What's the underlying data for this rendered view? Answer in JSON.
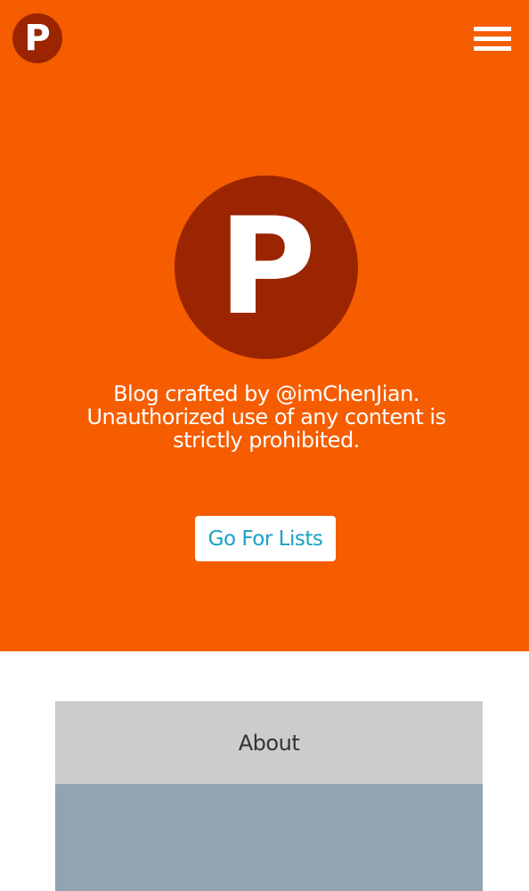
{
  "header": {
    "logo_letter": "P",
    "menu_icon": "hamburger-menu-icon"
  },
  "hero": {
    "logo_letter": "P",
    "tagline_line1": "Blog crafted by @imChenJian.",
    "tagline_line2": "Unauthorized use of any content is",
    "tagline_line3": "strictly prohibited.",
    "cta_label": "Go For Lists"
  },
  "sections": {
    "about_label": "About"
  },
  "colors": {
    "hero_background": "#f55d00",
    "logo_circle": "#9b2500",
    "cta_text": "#17a2c6",
    "about_header_bg": "#cccccc",
    "about_body_bg": "#93a3b0"
  }
}
